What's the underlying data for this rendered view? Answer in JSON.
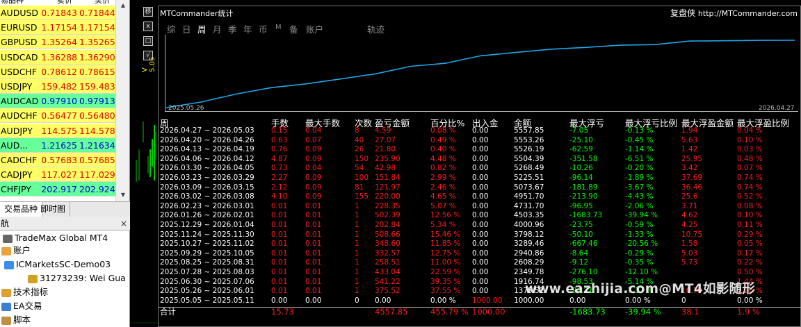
{
  "market_watch": {
    "col_symbol": "易品种",
    "col_bid": "卖价",
    "col_ask": "买价",
    "rows": [
      {
        "symbol": "AUDUSD",
        "bid": "0.71843",
        "ask": "0.71844",
        "dir": "up"
      },
      {
        "symbol": "EURUSD",
        "bid": "1.17154",
        "ask": "1.17154",
        "dir": "up"
      },
      {
        "symbol": "GBPUSD",
        "bid": "1.35264",
        "ask": "1.35265",
        "dir": "up"
      },
      {
        "symbol": "USDCAD",
        "bid": "1.36288",
        "ask": "1.36290",
        "dir": "up"
      },
      {
        "symbol": "USDCHF",
        "bid": "0.78612",
        "ask": "0.78615",
        "dir": "up"
      },
      {
        "symbol": "USDJPY",
        "bid": "159.482",
        "ask": "159.483",
        "dir": "up"
      },
      {
        "symbol": "AUDCAD",
        "bid": "0.97910",
        "ask": "0.97913",
        "dir": "dn"
      },
      {
        "symbol": "AUDCHF",
        "bid": "0.56477",
        "ask": "0.56480",
        "dir": "up"
      },
      {
        "symbol": "AUDJPY",
        "bid": "114.575",
        "ask": "114.578",
        "dir": "up"
      },
      {
        "symbol": "AUD...",
        "bid": "1.21625",
        "ask": "1.21634",
        "dir": "dn"
      },
      {
        "symbol": "CADCHF",
        "bid": "0.57683",
        "ask": "0.57685",
        "dir": "up"
      },
      {
        "symbol": "CADJPY",
        "bid": "117.027",
        "ask": "117.029",
        "dir": "up"
      },
      {
        "symbol": "CHFJPY",
        "bid": "202.917",
        "ask": "202.924",
        "dir": "dn"
      }
    ],
    "tabs": [
      "交易品种",
      "即时图"
    ]
  },
  "navigator": {
    "title": "航",
    "close": "×",
    "items": [
      {
        "label": "TradeMax Global MT4",
        "icon": "terminal-icon"
      },
      {
        "label": "账户",
        "icon": "accounts-icon"
      },
      {
        "label": "ICMarketsSC-Demo03",
        "icon": "server-icon"
      },
      {
        "label": "31273239: Wei Gua",
        "icon": "user-icon"
      },
      {
        "label": "技术指标",
        "icon": "indicators-icon"
      },
      {
        "label": "EA交易",
        "icon": "expert-advisors-icon"
      },
      {
        "label": "脚本",
        "icon": "scripts-icon"
      }
    ]
  },
  "chart_controls": [
    "移",
    "x",
    "□",
    "√"
  ],
  "chart_price_label": "V 5.05",
  "panel": {
    "title": "MTCommander统计",
    "brand": "复盘侠",
    "url": "http://MTCommander.com",
    "tabs": [
      "综",
      "日",
      "周",
      "月",
      "季",
      "年",
      "币",
      "M",
      "备",
      "账户",
      "轨迹"
    ],
    "active_tab": "周",
    "graph": {
      "start_date": "2025.05.26",
      "end_date": "2026.04.27",
      "line_color": "#1ea7e8"
    },
    "headers": [
      "周",
      "手数",
      "最大手数",
      "次数",
      "盈亏金额",
      "百分比%",
      "出入金",
      "余额",
      "最大浮亏",
      "最大浮亏比例",
      "最大浮盈金额",
      "最大浮盈比例"
    ],
    "rows": [
      [
        "2026.04.27 ~ 2026.05.03",
        "0.15",
        "0.04",
        "8",
        "4.59",
        "0.08 %",
        "0.00",
        "5557.85",
        "-7.05",
        "-0.13 %",
        "1.94",
        "0.04 %"
      ],
      [
        "2026.04.20 ~ 2026.04.26",
        "0.63",
        "0.07",
        "40",
        "27.07",
        "0.49 %",
        "0.00",
        "5553.26",
        "-25.10",
        "-0.45 %",
        "5.63",
        "0.10 %"
      ],
      [
        "2026.04.13 ~ 2026.04.19",
        "0.76",
        "0.09",
        "26",
        "21.80",
        "0.40 %",
        "0.00",
        "5526.19",
        "-62.59",
        "-1.14 %",
        "1.42",
        "0.03 %"
      ],
      [
        "2026.04.06 ~ 2026.04.12",
        "4.87",
        "0.09",
        "150",
        "235.90",
        "4.48 %",
        "0.00",
        "5504.39",
        "-351.58",
        "-6.51 %",
        "25.95",
        "0.48 %"
      ],
      [
        "2026.03.30 ~ 2026.04.05",
        "0.73",
        "0.04",
        "54",
        "42.98",
        "0.82 %",
        "0.00",
        "5268.49",
        "-10.26",
        "-0.20 %",
        "3.42",
        "0.07 %"
      ],
      [
        "2026.03.23 ~ 2026.03.29",
        "2.27",
        "0.09",
        "100",
        "151.84",
        "2.99 %",
        "0.00",
        "5225.51",
        "-96.14",
        "-1.89 %",
        "37.69",
        "0.74 %"
      ],
      [
        "2026.03.09 ~ 2026.03.15",
        "2.12",
        "0.09",
        "81",
        "121.97",
        "2.46 %",
        "0.00",
        "5073.67",
        "-181.89",
        "-3.67 %",
        "36.46",
        "0.74 %"
      ],
      [
        "2026.03.02 ~ 2026.03.08",
        "4.10",
        "0.09",
        "155",
        "220.00",
        "4.65 %",
        "0.00",
        "4951.70",
        "-213.90",
        "-4.43 %",
        "25.6",
        "0.52 %"
      ],
      [
        "2026.02.23 ~ 2026.03.01",
        "0.01",
        "0.01",
        "1",
        "228.35",
        "5.07 %",
        "0.00",
        "4731.70",
        "-96.95",
        "-2.06 %",
        "3.71",
        "0.08 %"
      ],
      [
        "2026.01.26 ~ 2026.02.01",
        "0.01",
        "0.01",
        "1",
        "502.39",
        "12.56 %",
        "0.00",
        "4503.35",
        "-1683.73",
        "-39.94 %",
        "4.62",
        "0.10 %"
      ],
      [
        "2025.12.29 ~ 2026.01.04",
        "0.01",
        "0.01",
        "1",
        "202.84",
        "5.34 %",
        "0.00",
        "4000.96",
        "-23.75",
        "-0.59 %",
        "4.25",
        "0.11 %"
      ],
      [
        "2025.11.24 ~ 2025.11.30",
        "0.01",
        "0.01",
        "1",
        "508.66",
        "15.46 %",
        "0.00",
        "3798.12",
        "-50.10",
        "-1.33 %",
        "10.75",
        "0.29 %"
      ],
      [
        "2025.10.27 ~ 2025.11.02",
        "0.01",
        "0.01",
        "1",
        "348.60",
        "11.85 %",
        "0.00",
        "3289.46",
        "-667.46",
        "-20.56 %",
        "1.58",
        "0.05 %"
      ],
      [
        "2025.09.29 ~ 2025.10.05",
        "0.01",
        "0.01",
        "1",
        "332.57",
        "12.75 %",
        "0.00",
        "2940.86",
        "-8.64",
        "-0.29 %",
        "5.03",
        "0.17 %"
      ],
      [
        "2025.08.25 ~ 2025.08.31",
        "0.01",
        "0.01",
        "1",
        "258.51",
        "11.00 %",
        "0.00",
        "2608.29",
        "-9.12",
        "-0.35 %",
        "5.73",
        "0.22 %"
      ],
      [
        "2025.07.28 ~ 2025.08.03",
        "0.01",
        "0.01",
        "1",
        "433.04",
        "22.59 %",
        "0.00",
        "2349.78",
        "-276.10",
        "-12.10 %",
        "",
        "0.50 %"
      ],
      [
        "2025.06.30 ~ 2025.07.06",
        "0.01",
        "0.01",
        "1",
        "541.22",
        "39.35 %",
        "0.00",
        "1916.74",
        "-98.53",
        "-5.14 %",
        "",
        "1.44 %"
      ],
      [
        "2025.05.26 ~ 2025.06.01",
        "0.01",
        "0.01",
        "1",
        "375.52",
        "37.55 %",
        "0.00",
        "1375.52",
        "-94.21",
        "-7.17 %",
        "16.79",
        "1.26 %"
      ],
      [
        "2025.05.05 ~ 2025.05.11",
        "0.00",
        "0.00",
        "0",
        "0.00",
        "0.00 %",
        "1000.00",
        "1000.00",
        "0.00",
        "0.00 %",
        "0",
        "0.00 %"
      ]
    ],
    "total": [
      "合计",
      "15.73",
      "",
      "",
      "4557.85",
      "455.79 %",
      "1000.00",
      "",
      "-1683.73",
      "-39.94 %",
      "38.1",
      "1.9 %"
    ]
  },
  "watermark": "www.eazhijia.com@MT4如影随形"
}
